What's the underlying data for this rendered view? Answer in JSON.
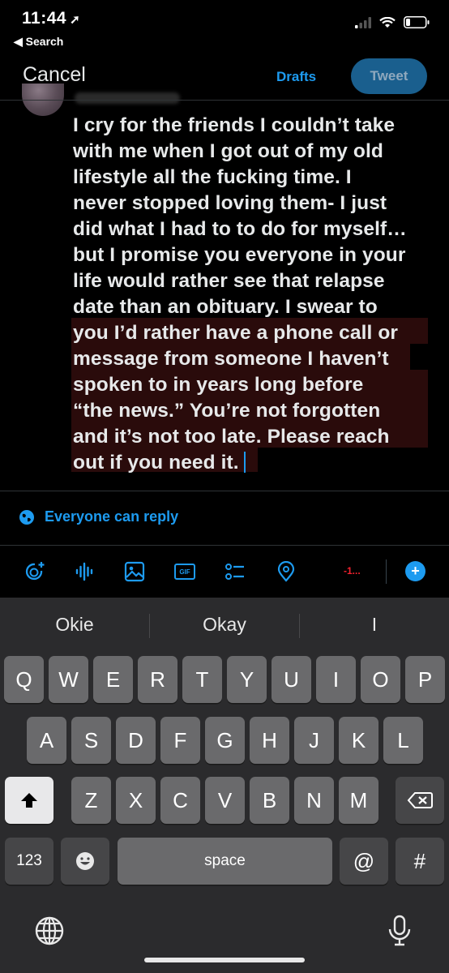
{
  "status_bar": {
    "time": "11:44",
    "back_label": "Search"
  },
  "header": {
    "cancel_label": "Cancel",
    "drafts_label": "Drafts",
    "tweet_label": "Tweet"
  },
  "tweet": {
    "lines": [
      "I cry for the friends I couldn’t take",
      "with me when I got out of my old",
      "lifestyle all the fucking time. I",
      "never stopped loving them- I just",
      "did what I had to to do for myself…",
      "but I promise you everyone in your",
      "life would rather see that relapse",
      "date than an obituary. I swear to",
      "you I’d rather have a phone call or",
      "message from someone I haven’t",
      "spoken to in years long before",
      "“the news.” You’re not forgotten",
      "and it’s not too late. Please reach",
      "out if you need it."
    ]
  },
  "reply_setting": {
    "label": "Everyone can reply",
    "icon": "globe-icon"
  },
  "toolbar": {
    "icons": [
      "sparkle-icon",
      "audio-wave-icon",
      "image-icon",
      "gif-icon",
      "poll-icon",
      "location-icon"
    ],
    "gif_text": "GIF",
    "char_count": "-1...",
    "plus_label": "+"
  },
  "keyboard": {
    "suggestions": [
      "Okie",
      "Okay",
      "I"
    ],
    "row1": [
      "Q",
      "W",
      "E",
      "R",
      "T",
      "Y",
      "U",
      "I",
      "O",
      "P"
    ],
    "row2": [
      "A",
      "S",
      "D",
      "F",
      "G",
      "H",
      "J",
      "K",
      "L"
    ],
    "row3": [
      "Z",
      "X",
      "C",
      "V",
      "B",
      "N",
      "M"
    ],
    "numbers_label": "123",
    "space_label": "space",
    "at_label": "@",
    "hash_label": "#",
    "accent": "#1d9bf0",
    "count_color": "#f4212e"
  }
}
